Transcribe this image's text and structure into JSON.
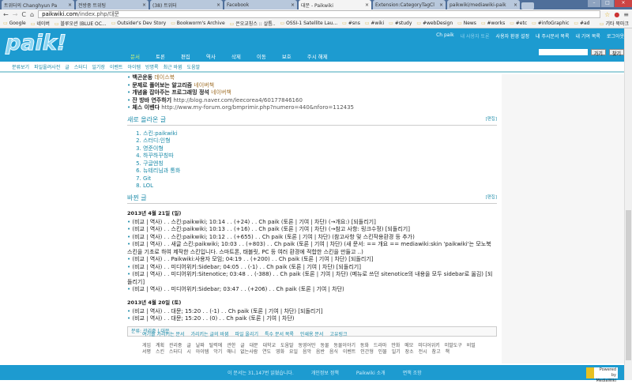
{
  "browser": {
    "tabs": [
      "트위터의 Changhyun Pa",
      "전방중 트위팅",
      "(38) 트위터",
      "Facebook",
      "대문 - Paikwiki",
      "Extension:CategoryTagCl",
      "paikwiki/mediawiki-paik"
    ],
    "url_domain": "paikwiki.com",
    "url_path": "/index.php/대문",
    "bookmarks": [
      "Google",
      "네이버",
      "블루오션 (BLUE OC...",
      "Outsider's Dev Story",
      "Bookworm's Archive",
      "은오교칭스 :: 살틈..",
      "OSSI-1 Satellite Lau...",
      "#sns",
      "#wiki",
      "#study",
      "#webDesign",
      "News",
      "#works",
      "#etc",
      "#infoGraphic",
      "#ad"
    ],
    "other_bookmarks": "기타 북마크"
  },
  "header": {
    "logo": "paik!",
    "personal": [
      "Ch paik",
      "내 사용자 토론",
      "사용자 환경 설정",
      "내 주시문서 목록",
      "내 기여 목록",
      "로그아웃"
    ],
    "search_go": "가기",
    "search_find": "찾기",
    "search_value": ""
  },
  "nav": [
    "문서",
    "토론",
    "편집",
    "역사",
    "삭제",
    "이동",
    "보호",
    "주시 해제"
  ],
  "subnav": [
    "분류보기",
    "파일올려사전",
    "글",
    "스터디",
    "일기장",
    "이벤트",
    "아이템",
    "방명록",
    "최근 바뀜",
    "도움말"
  ],
  "books": [
    {
      "title": "백곤운동",
      "link": "데이스북"
    },
    {
      "title": "문제로 풀어보는 알고리즘",
      "link": "네이버책"
    },
    {
      "title": "개념을 잡아주는 프로그래밍 정석",
      "link": "네이버책"
    },
    {
      "title": "잔 방바",
      "extra": "연주하기",
      "link": "http://blog.naver.com/leecorea4/60177846160"
    },
    {
      "title": "체스 이벤다",
      "link": "http://www.my-forum.org/bmprimir.php?numero=440&nforo=112435"
    }
  ],
  "new_posts": {
    "title": "새로 올라온 글",
    "edit": "[편집]",
    "items": [
      "스킨:paikwiki",
      "스터디:인형",
      "영준이형",
      "하꾸하꾸칭따",
      "구글엔칭",
      "뉴테리님과 통화",
      "Git",
      "LOL"
    ]
  },
  "recent": {
    "title": "바뀐 글",
    "edit": "[편집]",
    "days": [
      {
        "date": "2013년 4월 21일 (일)",
        "rows": [
          "(비교 | 역사) . . 스킨:paikwiki; 10:14 . . (+24) . . Ch paik (토론 | 기여 | 차단) (→개요:) [되돌리기]",
          "(비교 | 역사) . . 스킨:paikwiki; 10:13 . . (+16) . . Ch paik (토론 | 기여 | 차단) (→참고 사항: 링크수정) [되돌리기]",
          "(비교 | 역사) . . 스킨:paikwiki; 10:12 . . (+655) . . Ch paik (토론 | 기여 | 차단) (참고사항 및 스킨작용환경 등 추가)",
          "(비교 | 역사) . . 새글 스킨:paikwiki; 10:03 . . (+803) . . Ch paik (토론 | 기여 | 차단) (새 문서: == 개요 == mediawiki:skin 'paikwiki'는 모노북 스킨을 기초로 하여 제작한 스킨입니다. 스마트폰, 태블릿, PC 등 여러 환경에 적합한 스킨을 만들고 ..)",
          "(비교 | 역사) . . Paikwiki:사용자 모임; 04:19 . . (+200) . . Ch paik (토론 | 기여 | 차단) [되돌리기]",
          "(비교 | 역사) . . 미디어위키:Sidebar; 04:05 . . (-1) . . Ch paik (토론 | 기여 | 차단) [되돌리기]",
          "(비교 | 역사) . . 미디어위키:Sitenotice; 03:48 . . (-388) . . Ch paik (토론 | 기여 | 차단) (메뉴로 쓰던 sitenotice의 내용을 모두 sidebar로 옮김) [되돌리기]",
          "(비교 | 역사) . . 미디어위키:Sidebar; 03:47 . . (+206) . . Ch paik (토론 | 기여 | 차단)"
        ]
      },
      {
        "date": "2013년 4월 20일 (토)",
        "rows": [
          "(비교 | 역사) . . 대문; 15:20 . . (-1) . . Ch paik (토론 | 기여 | 차단) [되돌리기]",
          "(비교 | 역사) . . 대문; 15:20 . . (0) . . Ch paik (토론 | 기여 | 차단)"
        ]
      }
    ]
  },
  "category": {
    "label": "분류:",
    "items": "관리중 | 대문"
  },
  "toolbox": [
    "여기를 가리키는 문서",
    "가리키는 글의 바뀜",
    "파일 올리기",
    "특수 문서 목록",
    "인쇄용 문서",
    "고유링크"
  ],
  "categories_all": "게임 계획 관리중 글 날짜 탈력에 관한 글 대문 대학교 도움말 동영어만 동물 동물이야기 동화 드라마 만화 메모 미디어위키 미발도구 비밀 서평 스킨 스터디 시 아이템 악기 애니 없는사람 연도 영화 요일 음악 음반 음식 이벤트 인간형 인물 일기 장소 전시 참고 책",
  "footer": {
    "views": "이 문서는 31,147번 읽혔습니다.",
    "privacy": "개인정보 정책",
    "about": "Paikwiki 소개",
    "disclaimer": "면책 조항",
    "powered": "Powered by MediaWiki"
  }
}
